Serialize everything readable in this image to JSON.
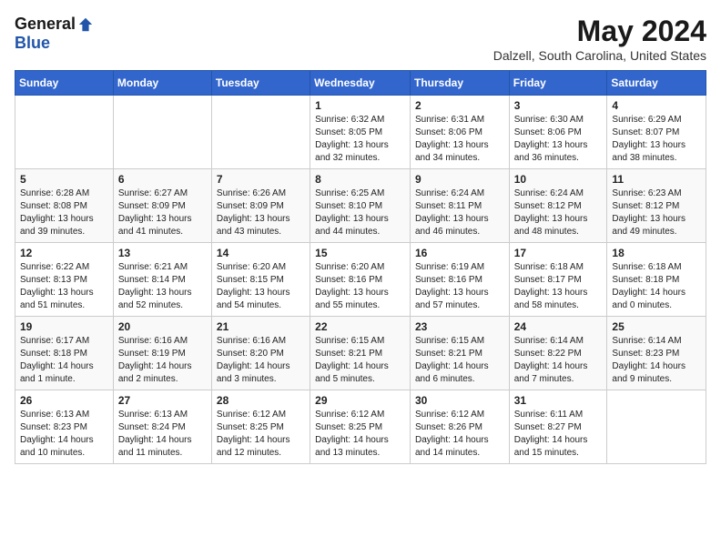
{
  "logo": {
    "general": "General",
    "blue": "Blue"
  },
  "title": "May 2024",
  "location": "Dalzell, South Carolina, United States",
  "weekdays": [
    "Sunday",
    "Monday",
    "Tuesday",
    "Wednesday",
    "Thursday",
    "Friday",
    "Saturday"
  ],
  "weeks": [
    [
      {
        "day": "",
        "info": ""
      },
      {
        "day": "",
        "info": ""
      },
      {
        "day": "",
        "info": ""
      },
      {
        "day": "1",
        "info": "Sunrise: 6:32 AM\nSunset: 8:05 PM\nDaylight: 13 hours and 32 minutes."
      },
      {
        "day": "2",
        "info": "Sunrise: 6:31 AM\nSunset: 8:06 PM\nDaylight: 13 hours and 34 minutes."
      },
      {
        "day": "3",
        "info": "Sunrise: 6:30 AM\nSunset: 8:06 PM\nDaylight: 13 hours and 36 minutes."
      },
      {
        "day": "4",
        "info": "Sunrise: 6:29 AM\nSunset: 8:07 PM\nDaylight: 13 hours and 38 minutes."
      }
    ],
    [
      {
        "day": "5",
        "info": "Sunrise: 6:28 AM\nSunset: 8:08 PM\nDaylight: 13 hours and 39 minutes."
      },
      {
        "day": "6",
        "info": "Sunrise: 6:27 AM\nSunset: 8:09 PM\nDaylight: 13 hours and 41 minutes."
      },
      {
        "day": "7",
        "info": "Sunrise: 6:26 AM\nSunset: 8:09 PM\nDaylight: 13 hours and 43 minutes."
      },
      {
        "day": "8",
        "info": "Sunrise: 6:25 AM\nSunset: 8:10 PM\nDaylight: 13 hours and 44 minutes."
      },
      {
        "day": "9",
        "info": "Sunrise: 6:24 AM\nSunset: 8:11 PM\nDaylight: 13 hours and 46 minutes."
      },
      {
        "day": "10",
        "info": "Sunrise: 6:24 AM\nSunset: 8:12 PM\nDaylight: 13 hours and 48 minutes."
      },
      {
        "day": "11",
        "info": "Sunrise: 6:23 AM\nSunset: 8:12 PM\nDaylight: 13 hours and 49 minutes."
      }
    ],
    [
      {
        "day": "12",
        "info": "Sunrise: 6:22 AM\nSunset: 8:13 PM\nDaylight: 13 hours and 51 minutes."
      },
      {
        "day": "13",
        "info": "Sunrise: 6:21 AM\nSunset: 8:14 PM\nDaylight: 13 hours and 52 minutes."
      },
      {
        "day": "14",
        "info": "Sunrise: 6:20 AM\nSunset: 8:15 PM\nDaylight: 13 hours and 54 minutes."
      },
      {
        "day": "15",
        "info": "Sunrise: 6:20 AM\nSunset: 8:16 PM\nDaylight: 13 hours and 55 minutes."
      },
      {
        "day": "16",
        "info": "Sunrise: 6:19 AM\nSunset: 8:16 PM\nDaylight: 13 hours and 57 minutes."
      },
      {
        "day": "17",
        "info": "Sunrise: 6:18 AM\nSunset: 8:17 PM\nDaylight: 13 hours and 58 minutes."
      },
      {
        "day": "18",
        "info": "Sunrise: 6:18 AM\nSunset: 8:18 PM\nDaylight: 14 hours and 0 minutes."
      }
    ],
    [
      {
        "day": "19",
        "info": "Sunrise: 6:17 AM\nSunset: 8:18 PM\nDaylight: 14 hours and 1 minute."
      },
      {
        "day": "20",
        "info": "Sunrise: 6:16 AM\nSunset: 8:19 PM\nDaylight: 14 hours and 2 minutes."
      },
      {
        "day": "21",
        "info": "Sunrise: 6:16 AM\nSunset: 8:20 PM\nDaylight: 14 hours and 3 minutes."
      },
      {
        "day": "22",
        "info": "Sunrise: 6:15 AM\nSunset: 8:21 PM\nDaylight: 14 hours and 5 minutes."
      },
      {
        "day": "23",
        "info": "Sunrise: 6:15 AM\nSunset: 8:21 PM\nDaylight: 14 hours and 6 minutes."
      },
      {
        "day": "24",
        "info": "Sunrise: 6:14 AM\nSunset: 8:22 PM\nDaylight: 14 hours and 7 minutes."
      },
      {
        "day": "25",
        "info": "Sunrise: 6:14 AM\nSunset: 8:23 PM\nDaylight: 14 hours and 9 minutes."
      }
    ],
    [
      {
        "day": "26",
        "info": "Sunrise: 6:13 AM\nSunset: 8:23 PM\nDaylight: 14 hours and 10 minutes."
      },
      {
        "day": "27",
        "info": "Sunrise: 6:13 AM\nSunset: 8:24 PM\nDaylight: 14 hours and 11 minutes."
      },
      {
        "day": "28",
        "info": "Sunrise: 6:12 AM\nSunset: 8:25 PM\nDaylight: 14 hours and 12 minutes."
      },
      {
        "day": "29",
        "info": "Sunrise: 6:12 AM\nSunset: 8:25 PM\nDaylight: 14 hours and 13 minutes."
      },
      {
        "day": "30",
        "info": "Sunrise: 6:12 AM\nSunset: 8:26 PM\nDaylight: 14 hours and 14 minutes."
      },
      {
        "day": "31",
        "info": "Sunrise: 6:11 AM\nSunset: 8:27 PM\nDaylight: 14 hours and 15 minutes."
      },
      {
        "day": "",
        "info": ""
      }
    ]
  ]
}
